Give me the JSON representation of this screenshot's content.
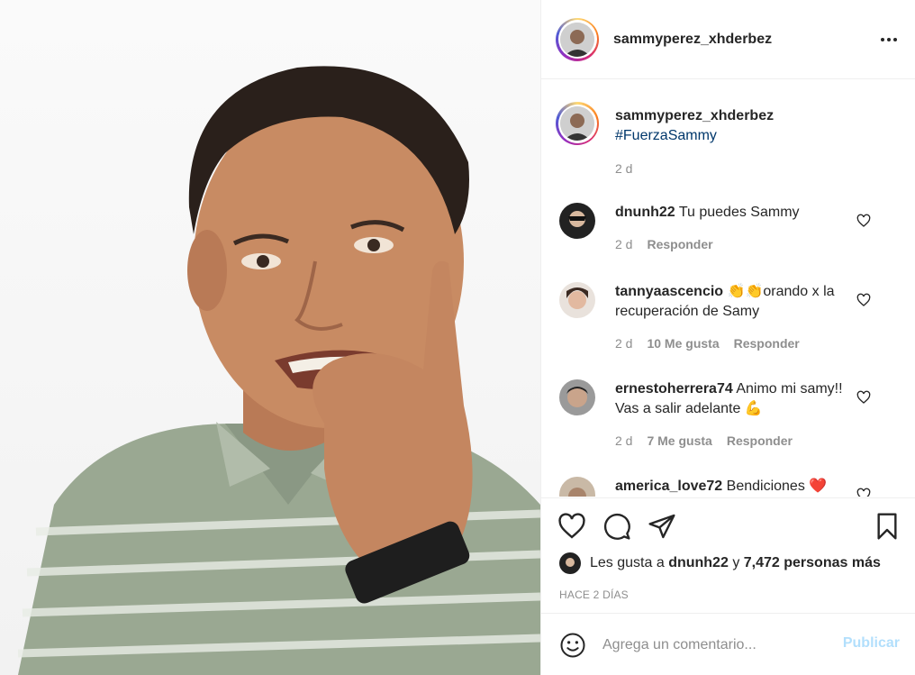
{
  "post": {
    "owner": "sammyperez_xhderbez",
    "caption_hashtag": "#FuerzaSammy",
    "caption_time": "2 d"
  },
  "comments": [
    {
      "user": "dnunh22",
      "text": "Tu puedes Sammy",
      "time": "2 d",
      "likes": "",
      "reply": "Responder"
    },
    {
      "user": "tannyaascencio",
      "text": "👏👏orando x la recuperación de Samy",
      "time": "2 d",
      "likes": "10 Me gusta",
      "reply": "Responder"
    },
    {
      "user": "ernestoherrera74",
      "text": "Animo mi samy!! Vas a salir adelante 💪",
      "time": "2 d",
      "likes": "7 Me gusta",
      "reply": "Responder"
    },
    {
      "user": "america_love72",
      "text": "Bendiciones ❤️",
      "time": "",
      "likes": "",
      "reply": ""
    }
  ],
  "likes_line": {
    "prefix": "Les gusta a",
    "user": "dnunh22",
    "conj": "y",
    "count": "7,472 personas más"
  },
  "timestamp": "HACE 2 DÍAS",
  "add_comment": {
    "placeholder": "Agrega un comentario...",
    "publish_label": "Publicar"
  },
  "colors": {
    "link": "#00376b",
    "muted": "#8e8e8e",
    "publish_disabled": "#b2dffc"
  },
  "icons": [
    "more-options-icon",
    "heart-icon",
    "comment-icon",
    "share-icon",
    "bookmark-icon",
    "emoji-icon"
  ]
}
